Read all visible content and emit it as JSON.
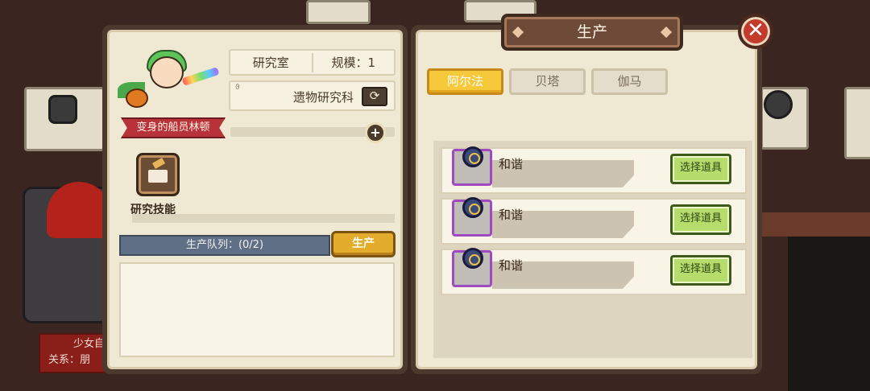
{
  "background": {
    "side_character": {
      "name": "少女自",
      "relation": "关系：朋"
    }
  },
  "left_panel": {
    "character_name": "变身的船员林顿",
    "room_label": "研究室",
    "scale_label": "规模：1",
    "department": "遗物研究科",
    "refresh_icon": "refresh-icon",
    "plus_icon": "plus-icon",
    "skill_label": "研究技能",
    "queue_label": "生产队列：(0/2)",
    "produce_button": "生产"
  },
  "right_panel": {
    "title": "生产",
    "close_icon": "close-icon",
    "tabs": [
      {
        "label": "阿尔法",
        "active": true
      },
      {
        "label": "贝塔",
        "active": false
      },
      {
        "label": "伽马",
        "active": false
      }
    ],
    "items": [
      {
        "name": "和谐",
        "button": "选择道具"
      },
      {
        "name": "和谐",
        "button": "选择道具"
      },
      {
        "name": "和谐",
        "button": "选择道具"
      }
    ]
  },
  "colors": {
    "panel_frame": "#4b3a2d",
    "panel_fill": "#efe8d2",
    "tab_active": "#f5c93a",
    "produce_button": "#e3ac2c",
    "pick_button": "#b6dc6c",
    "close_button": "#c43a2c",
    "queue_bar": "#5f6f85"
  }
}
